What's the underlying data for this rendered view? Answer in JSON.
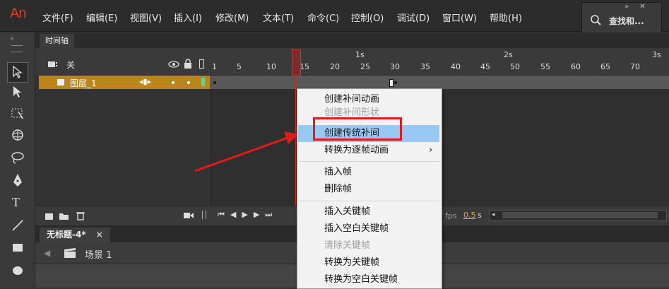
{
  "app": {
    "logo": "An"
  },
  "menus": [
    "文件(F)",
    "编辑(E)",
    "视图(V)",
    "插入(I)",
    "修改(M)",
    "文本(T)",
    "命令(C)",
    "控制(O)",
    "调试(D)",
    "窗口(W)",
    "帮助(H)"
  ],
  "search": {
    "label": "查找和...",
    "controls": "»  ✕"
  },
  "timeline": {
    "tab": "时间轴",
    "layer_header": "关",
    "layer_name": "图层_1",
    "seconds": [
      "1s",
      "2s",
      "3s"
    ],
    "frame_numbers": [
      "1",
      "5",
      "10",
      "15",
      "20",
      "25",
      "30",
      "35",
      "40",
      "45",
      "50",
      "55",
      "60",
      "65",
      "70"
    ],
    "fps_label": "fps",
    "time_value": "0.5",
    "time_unit": "s"
  },
  "document": {
    "tab": "无标题-4*",
    "close": "×",
    "scene": "场景 1"
  },
  "context_menu": {
    "items": [
      {
        "label": "创建补间动画",
        "disabled": false
      },
      {
        "label": "创建补间形状",
        "disabled": true
      },
      {
        "label": "创建传统补间",
        "disabled": false,
        "highlighted": true
      },
      {
        "label": "转换为逐帧动画",
        "disabled": false,
        "submenu": "›"
      },
      {
        "label": "插入帧",
        "disabled": false
      },
      {
        "label": "删除帧",
        "disabled": false
      },
      {
        "label": "插入关键帧",
        "disabled": false
      },
      {
        "label": "插入空白关键帧",
        "disabled": false
      },
      {
        "label": "清除关键帧",
        "disabled": true
      },
      {
        "label": "转换为关键帧",
        "disabled": false
      },
      {
        "label": "转换为空白关键帧",
        "disabled": false
      }
    ]
  },
  "colors": {
    "accent": "#e01b1b",
    "highlight": "#99c8f2",
    "layer": "#b8861b"
  }
}
